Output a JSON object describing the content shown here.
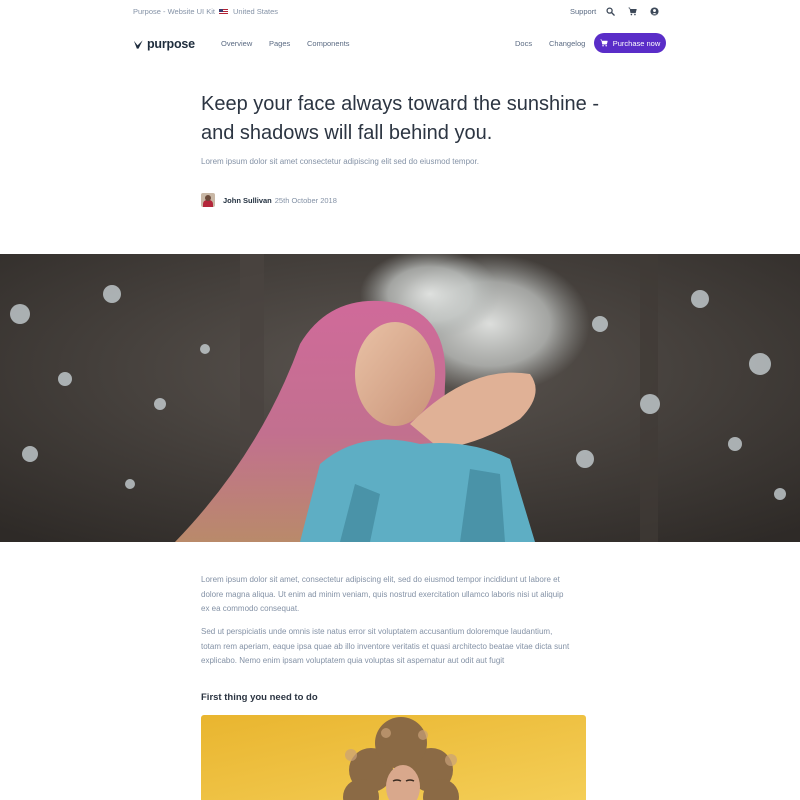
{
  "topbar": {
    "brand_link": "Purpose - Website UI Kit",
    "country": "United States",
    "support": "Support",
    "icons": [
      "search-icon",
      "cart-icon",
      "user-icon"
    ]
  },
  "nav": {
    "logo_text": "purpose",
    "links": [
      "Overview",
      "Pages",
      "Components"
    ],
    "docs": "Docs",
    "changelog": "Changelog",
    "cta_label": "Purchase now",
    "accent_color": "#5a2dc8"
  },
  "article": {
    "headline_line1": "Keep your face always toward the sunshine -",
    "headline_line2": "and shadows will fall behind you.",
    "subheading": "Lorem ipsum dolor sit amet consectetur adipiscing elit sed do eiusmod tempor.",
    "author_name": "John Sullivan",
    "date": "25th October 2018",
    "paragraphs": [
      {
        "lines": [
          "Lorem ipsum dolor sit amet, consectetur adipiscing elit, sed do eiusmod tempor incididunt ut labore et",
          "dolore magna aliqua. Ut enim ad minim veniam, quis nostrud exercitation ullamco laboris nisi ut aliquip",
          "ex ea commodo consequat."
        ]
      },
      {
        "lines": [
          "Sed ut perspiciatis unde omnis iste natus error sit voluptatem accusantium doloremque laudantium,",
          "totam rem aperiam, eaque ipsa quae ab illo inventore veritatis et quasi architecto beatae vitae dicta sunt",
          "explicabo. Nemo enim ipsam voluptatem quia voluptas sit aspernatur aut odit aut fugit"
        ]
      }
    ],
    "section_title": "First thing you need to do"
  }
}
